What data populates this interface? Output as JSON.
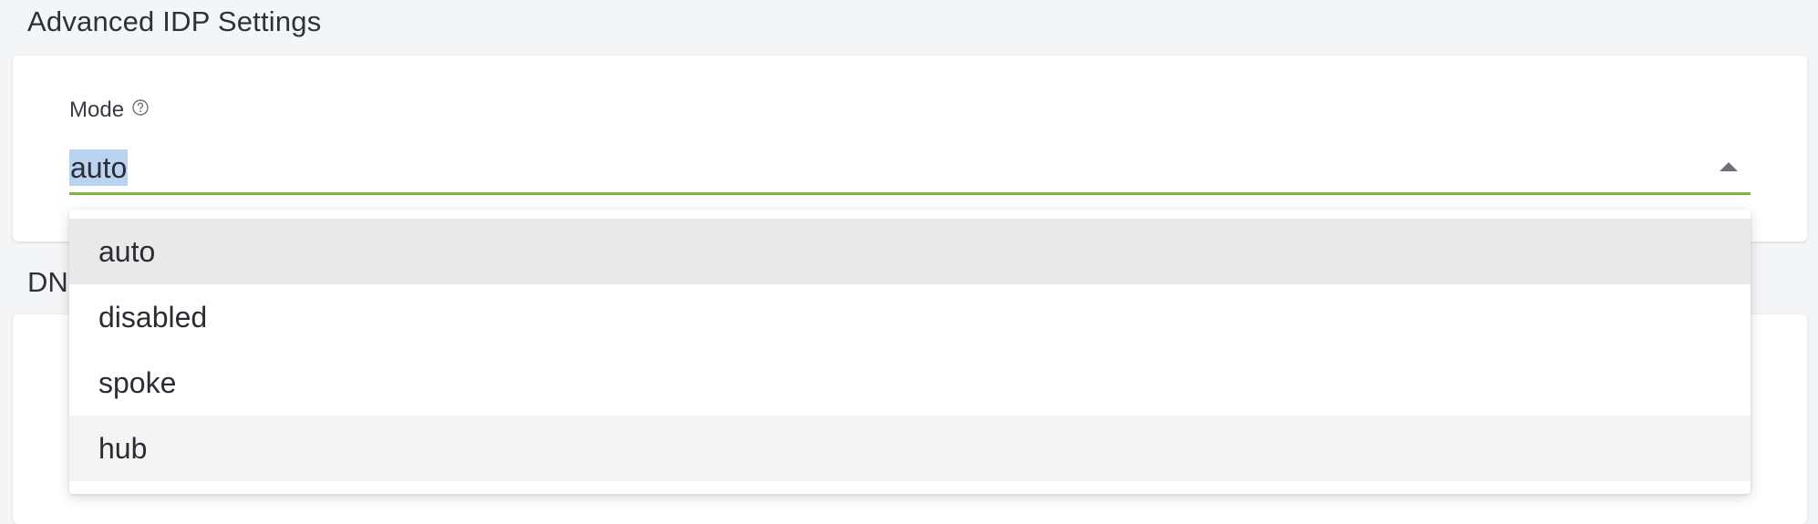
{
  "section": {
    "title": "Advanced IDP Settings",
    "next_title": "DN"
  },
  "mode": {
    "label": "Mode",
    "help_icon": "help-circle-icon",
    "value": "auto",
    "expanded": true,
    "options": [
      "auto",
      "disabled",
      "spoke",
      "hub"
    ],
    "selected_option": "auto",
    "hovered_option": "hub"
  },
  "colors": {
    "accent_underline": "#7cb342",
    "selection_highlight": "#b9d3f0"
  }
}
